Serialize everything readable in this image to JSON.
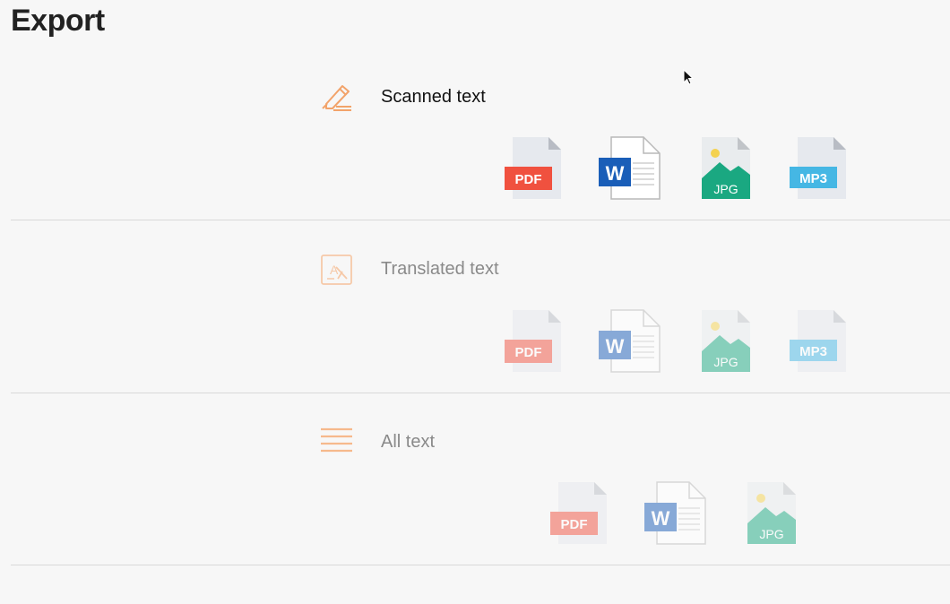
{
  "page": {
    "title": "Export"
  },
  "sections": [
    {
      "label": "Scanned text",
      "icon": "highlighter-icon",
      "formats": [
        "PDF",
        "W",
        "JPG",
        "MP3"
      ]
    },
    {
      "label": "Translated text",
      "icon": "translate-icon",
      "formats": [
        "PDF",
        "W",
        "JPG",
        "MP3"
      ]
    },
    {
      "label": "All text",
      "icon": "lines-icon",
      "formats": [
        "PDF",
        "W",
        "JPG"
      ]
    }
  ],
  "colors": {
    "pdf": "#f0513f",
    "word": "#1a5eb8",
    "jpg": "#1aa881",
    "mp3": "#45b7e4",
    "accent": "#f2a36a"
  }
}
